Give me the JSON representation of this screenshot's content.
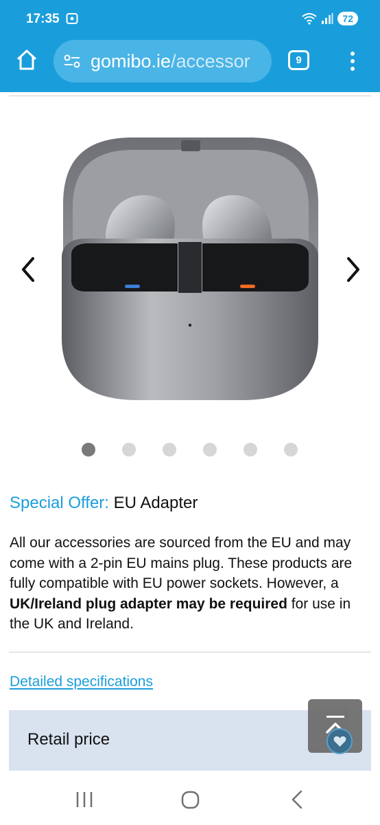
{
  "status_bar": {
    "time": "17:35",
    "battery": "72",
    "icons": [
      "screen-record-icon",
      "wifi-icon",
      "signal-icon",
      "battery-icon"
    ]
  },
  "browser": {
    "url_domain": "gomibo.ie",
    "url_path": "/accessor",
    "tab_count": "9",
    "icons": [
      "home-icon",
      "site-settings-icon",
      "tabs-icon",
      "more-vert-icon"
    ],
    "accent_color": "#1a9edb"
  },
  "gallery": {
    "image_alt": "Wireless earbuds in charging case",
    "slide_count": 6,
    "active_slide": 1,
    "icons": [
      "chevron-left-icon",
      "chevron-right-icon"
    ]
  },
  "offer": {
    "label": "Special Offer:",
    "value": " EU Adapter"
  },
  "description": {
    "part1": "All our accessories are sourced from the EU and may come with a 2-pin EU mains plug. These products are fully compatible with EU power sockets. However, a ",
    "bold": "UK/Ireland plug adapter may be required",
    "part2": " for use in the UK and Ireland."
  },
  "specs": {
    "link_label": "Detailed specifications"
  },
  "price": {
    "label": "Retail price"
  },
  "floating": {
    "icons": [
      "back-to-top-icon",
      "heart-icon"
    ]
  },
  "system_nav": {
    "icons": [
      "recent-apps-icon",
      "home-nav-icon",
      "back-nav-icon"
    ]
  }
}
